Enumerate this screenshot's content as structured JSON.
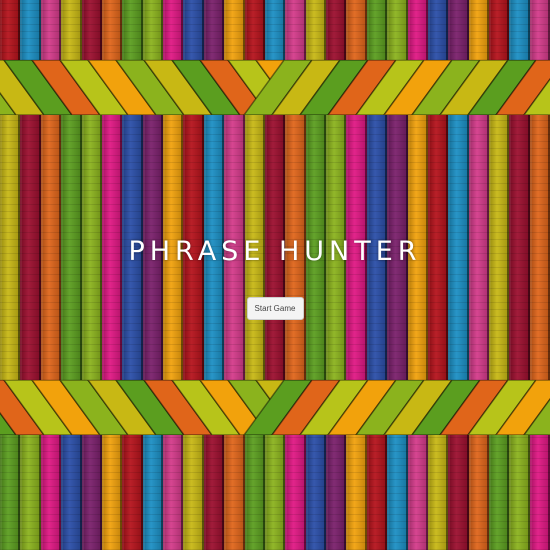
{
  "game": {
    "title": "PHRASE HUNTER",
    "start_button_label": "Start Game"
  },
  "theme": {
    "plank_colors": [
      "#b5121b",
      "#e0651a",
      "#7a1f6b",
      "#c8b814",
      "#e01783",
      "#1b8fc4",
      "#5b9e1f",
      "#f2a20c",
      "#9c0e2e",
      "#2a4ea8",
      "#d43a8a",
      "#8bb31d"
    ],
    "floor_colors": [
      "#f2a20c",
      "#8bb31d",
      "#c8b814",
      "#5b9e1f",
      "#e0651a",
      "#b7c41a"
    ]
  }
}
